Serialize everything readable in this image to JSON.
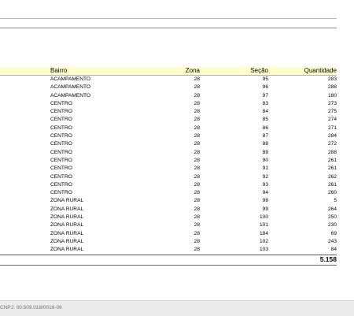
{
  "table": {
    "headers": {
      "bairro": "Bairro",
      "zona": "Zona",
      "secao": "Seção",
      "quantidade": "Quantidade"
    },
    "rows": [
      {
        "bairro": "ACAMPAMENTO",
        "zona": "28",
        "secao": "95",
        "quantidade": "283"
      },
      {
        "bairro": "ACAMPAMENTO",
        "zona": "28",
        "secao": "96",
        "quantidade": "288"
      },
      {
        "bairro": "ACAMPAMENTO",
        "zona": "28",
        "secao": "97",
        "quantidade": "180"
      },
      {
        "bairro": "CENTRO",
        "zona": "28",
        "secao": "83",
        "quantidade": "273"
      },
      {
        "bairro": "CENTRO",
        "zona": "28",
        "secao": "84",
        "quantidade": "275"
      },
      {
        "bairro": "CENTRO",
        "zona": "28",
        "secao": "85",
        "quantidade": "274"
      },
      {
        "bairro": "CENTRO",
        "zona": "28",
        "secao": "86",
        "quantidade": "271"
      },
      {
        "bairro": "CENTRO",
        "zona": "28",
        "secao": "87",
        "quantidade": "284"
      },
      {
        "bairro": "CENTRO",
        "zona": "28",
        "secao": "88",
        "quantidade": "272"
      },
      {
        "bairro": "CENTRO",
        "zona": "28",
        "secao": "89",
        "quantidade": "288"
      },
      {
        "bairro": "CENTRO",
        "zona": "28",
        "secao": "90",
        "quantidade": "261"
      },
      {
        "bairro": "CENTRO",
        "zona": "28",
        "secao": "91",
        "quantidade": "261"
      },
      {
        "bairro": "CENTRO",
        "zona": "28",
        "secao": "92",
        "quantidade": "262"
      },
      {
        "bairro": "CENTRO",
        "zona": "28",
        "secao": "93",
        "quantidade": "261"
      },
      {
        "bairro": "CENTRO",
        "zona": "28",
        "secao": "94",
        "quantidade": "260"
      },
      {
        "bairro": "ZONA RURAL",
        "zona": "28",
        "secao": "98",
        "quantidade": "5"
      },
      {
        "bairro": "ZONA RURAL",
        "zona": "28",
        "secao": "99",
        "quantidade": "264"
      },
      {
        "bairro": "ZONA RURAL",
        "zona": "28",
        "secao": "100",
        "quantidade": "250"
      },
      {
        "bairro": "ZONA RURAL",
        "zona": "28",
        "secao": "101",
        "quantidade": "230"
      },
      {
        "bairro": "ZONA RURAL",
        "zona": "28",
        "secao": "184",
        "quantidade": "69"
      },
      {
        "bairro": "ZONA RURAL",
        "zona": "28",
        "secao": "102",
        "quantidade": "243"
      },
      {
        "bairro": "ZONA RURAL",
        "zona": "28",
        "secao": "103",
        "quantidade": "84"
      }
    ],
    "total": "5.158"
  },
  "footer": {
    "cnpj": "CNPJ: 00.509.018/0016-06"
  },
  "colors": {
    "header_bg": "#ffffcc",
    "footer_bg": "#ececec"
  }
}
